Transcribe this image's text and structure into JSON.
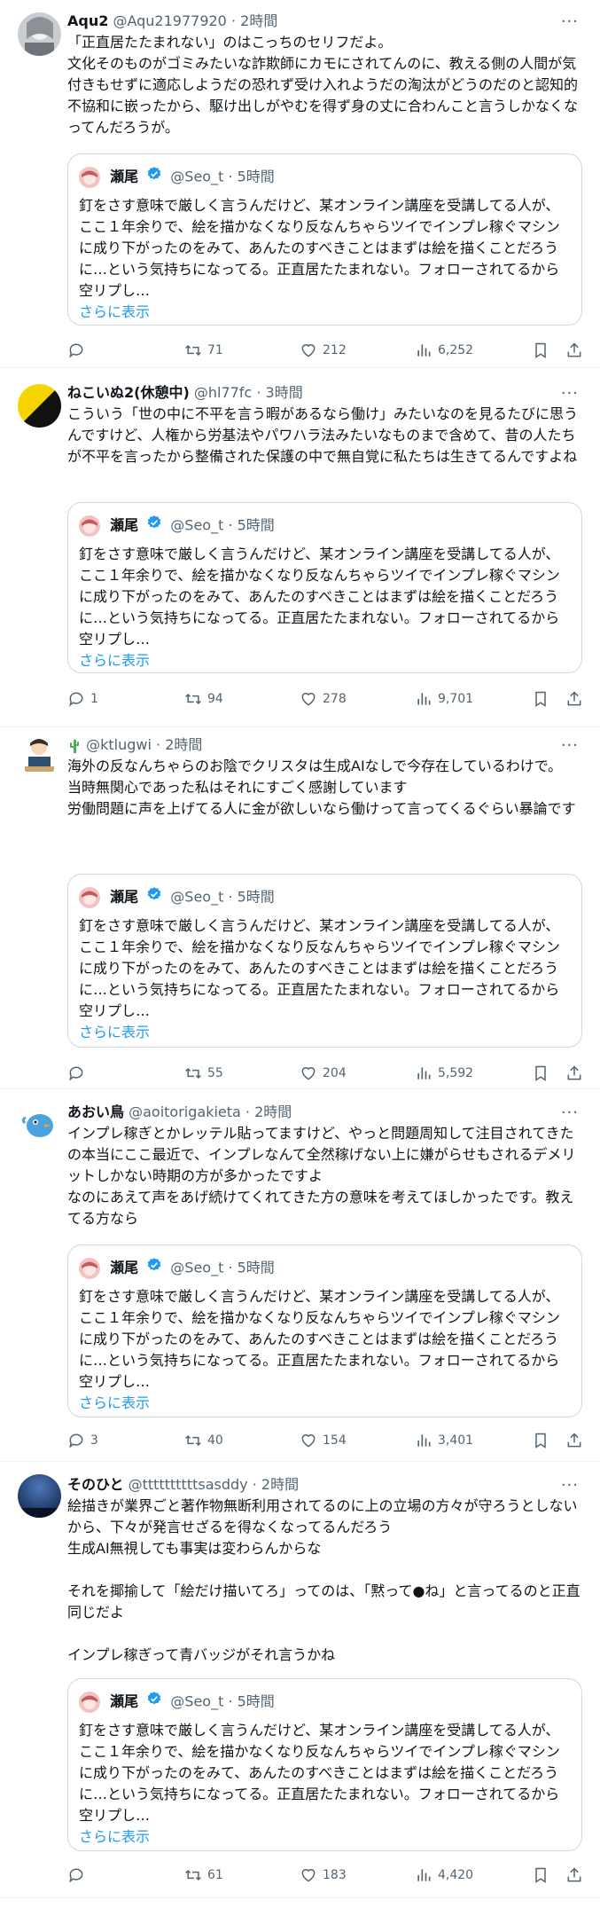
{
  "icons": {
    "reply": "speech-bubble-icon",
    "retweet": "retweet-arrows-icon",
    "like": "heart-icon",
    "views": "bar-chart-icon",
    "bookmark": "bookmark-icon",
    "share": "share-icon",
    "more": "ellipsis-icon",
    "verified": "verified-badge-icon"
  },
  "colors": {
    "accent": "#1d9bf0",
    "secondary_text": "#536471",
    "border": "#cfd9de"
  },
  "quoted_tweet": {
    "name": "瀬尾",
    "handle": "@Seo_t",
    "time": "5時間",
    "text": "釘をさす意味で厳しく言うんだけど、某オンライン講座を受講してる人が、ここ１年余りで、絵を描かなくなり反なんちゃらツイでインプレ稼ぐマシンに成り下がったのをみて、あんたのすべきことはまずは絵を描くことだろうに…という気持ちになってる。正直居たたまれない。フォローされてるから空リプし…",
    "show_more": "さらに表示"
  },
  "tweets": [
    {
      "name": "Aqu2",
      "handle": "@Aqu21977920",
      "time": "2時間",
      "text": "「正直居たたまれない」のはこっちのセリフだよ。\n文化そのものがゴミみたいな詐欺師にカモにされてんのに、教える側の人間が気付きもせずに適応しようだの恐れず受け入れようだの淘汰がどうのだのと認知的不協和に嵌ったから、駆け出しがやむを得ず身の丈に合わんこと言うしかなくなってんだろうが。",
      "reply": "",
      "retweet": "71",
      "like": "212",
      "views": "6,252"
    },
    {
      "name": "ねこいぬ2(休憩中)",
      "handle": "@hl77fc",
      "time": "3時間",
      "text": "こういう「世の中に不平を言う暇があるなら働け」みたいなのを見るたびに思うんですけど、人権から労基法やパワハラ法みたいなものまで含めて、昔の人たちが不平を言ったから整備された保護の中で無自覚に私たちは生きてるんですよね",
      "reply": "1",
      "retweet": "94",
      "like": "278",
      "views": "9,701"
    },
    {
      "name": "",
      "handle": "@ktlugwi",
      "time": "2時間",
      "text": "海外の反なんちゃらのお陰でクリスタは生成AIなしで今存在しているわけで。\n当時無関心であった私はそれにすごく感謝しています\n労働問題に声を上げてる人に金が欲しいなら働けって言ってくるぐらい暴論です",
      "reply": "",
      "retweet": "55",
      "like": "204",
      "views": "5,592"
    },
    {
      "name": "あおい鳥",
      "handle": "@aoitorigakieta",
      "time": "2時間",
      "text": "インプレ稼ぎとかレッテル貼ってますけど、やっと問題周知して注目されてきたの本当にここ最近で、インプレなんて全然稼げない上に嫌がらせもされるデメリットしかない時期の方が多かったですよ\nなのにあえて声をあげ続けてくれてきた方の意味を考えてほしかったです。教えてる方なら",
      "reply": "3",
      "retweet": "40",
      "like": "154",
      "views": "3,401"
    },
    {
      "name": "そのひと",
      "handle": "@ttttttttttsasddy",
      "time": "2時間",
      "text": "絵描きが業界ごと著作物無断利用されてるのに上の立場の方々が守ろうとしないから、下々が発言せざるを得なくなってるんだろう\n生成AI無視しても事実は変わらんからな\n\nそれを揶揄して「絵だけ描いてろ」ってのは、「黙って●ね」と言ってるのと正直同じだよ\n\nインプレ稼ぎって青バッジがそれ言うかね",
      "reply": "",
      "retweet": "61",
      "like": "183",
      "views": "4,420"
    }
  ]
}
